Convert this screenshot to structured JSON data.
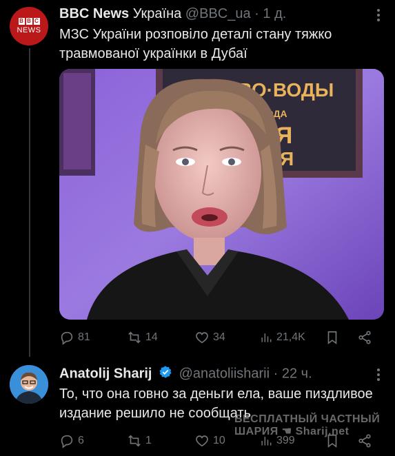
{
  "tweet1": {
    "avatar_text": "NEWS",
    "avatar_letters": [
      "B",
      "B",
      "C"
    ],
    "name": "BBC News",
    "name_suffix": "Україна",
    "handle": "@BBC_ua",
    "separator": "·",
    "time": "1 д.",
    "text": "МЗС України розповіло деталі стану тяжко травмованої українки в Дубаї",
    "media_background_text": "...ВО-ВОДЫ ... ЛЯ ... ИЯ",
    "stats": {
      "replies": "81",
      "reposts": "14",
      "likes": "34",
      "views": "21,4K"
    }
  },
  "tweet2": {
    "name": "Anatolij Sharij",
    "handle": "@anatoliisharii",
    "separator": "·",
    "time": "22 ч.",
    "text": "То, что она говно за деньги ела, ваше пиздливое издание решило не сообщать",
    "stats": {
      "replies": "6",
      "reposts": "1",
      "likes": "10",
      "views": "399"
    }
  },
  "watermark": {
    "line1": "БЕСПЛАТНЫЙ ЧАСТНЫЙ",
    "line2": "ШАРИЯ",
    "line2_site": "Sharij.net"
  },
  "colors": {
    "background": "#000000",
    "text": "#e7e9ea",
    "muted": "#71767b",
    "verified": "#1d9bf0",
    "bbc_red": "#bb1919"
  }
}
